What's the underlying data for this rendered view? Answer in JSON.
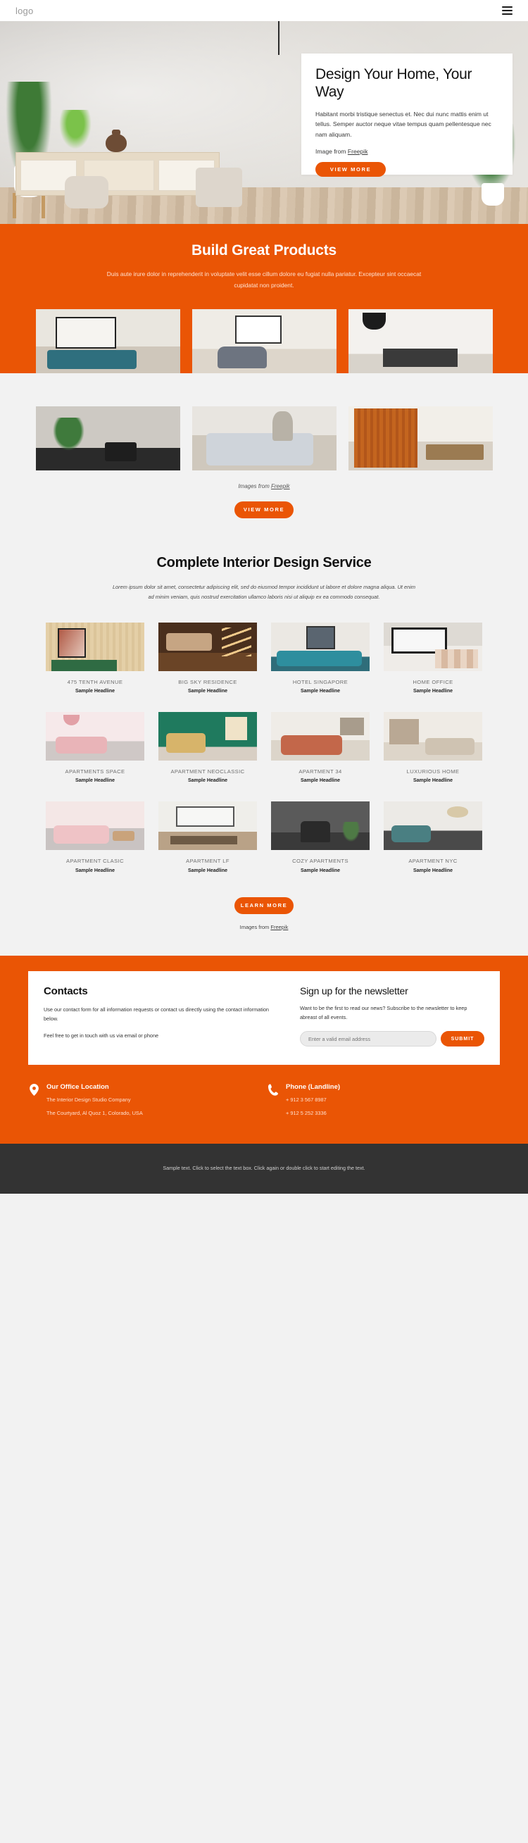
{
  "header": {
    "logo": "logo",
    "menu_icon": "hamburger-icon"
  },
  "hero": {
    "title": "Design Your Home, Your Way",
    "paragraph": "Habitant morbi tristique senectus et. Nec dui nunc mattis enim ut tellus. Semper auctor neque vitae tempus quam pellentesque nec nam aliquam.",
    "credit_prefix": "Image from ",
    "credit_link": "Freepik",
    "cta": "VIEW MORE"
  },
  "band": {
    "title": "Build Great Products",
    "paragraph": "Duis aute irure dolor in reprehenderit in voluptate velit esse cillum dolore eu fugiat nulla pariatur. Excepteur sint occaecat cupidatat non proident.",
    "credit_prefix": "Images from ",
    "credit_link": "Freepik",
    "cta": "VIEW MORE"
  },
  "service": {
    "title": "Complete Interior Design Service",
    "lead": "Lorem ipsum dolor sit amet, consectetur adipiscing elit, sed do eiusmod tempor incididunt ut labore et dolore magna aliqua. Ut enim ad minim veniam, quis nostrud exercitation ullamco laboris nisi ut aliquip ex ea commodo consequat.",
    "cta": "LEARN MORE",
    "credit_prefix": "Images from ",
    "credit_link": "Freepik",
    "cards": [
      {
        "title": "475 TENTH AVENUE",
        "subtitle": "Sample Headline"
      },
      {
        "title": "BIG SKY RESIDENCE",
        "subtitle": "Sample Headline"
      },
      {
        "title": "HOTEL SINGAPORE",
        "subtitle": "Sample Headline"
      },
      {
        "title": "HOME OFFICE",
        "subtitle": "Sample Headline"
      },
      {
        "title": "APARTMENTS SPACE",
        "subtitle": "Sample Headline"
      },
      {
        "title": "APARTMENT NEOCLASSIC",
        "subtitle": "Sample Headline"
      },
      {
        "title": "APARTMENT 34",
        "subtitle": "Sample Headline"
      },
      {
        "title": "LUXURIOUS HOME",
        "subtitle": "Sample Headline"
      },
      {
        "title": "APARTMENT CLASIC",
        "subtitle": "Sample Headline"
      },
      {
        "title": "APARTMENT LF",
        "subtitle": "Sample Headline"
      },
      {
        "title": "COZY APARTMENTS",
        "subtitle": "Sample Headline"
      },
      {
        "title": "APARTMENT NYC",
        "subtitle": "Sample Headline"
      }
    ]
  },
  "contacts": {
    "heading": "Contacts",
    "paragraph1": "Use our contact form for all information requests or contact us directly using the contact information below.",
    "paragraph2": "Feel free to get in touch with us via email or phone",
    "newsletter_heading": "Sign up for the newsletter",
    "newsletter_paragraph": "Want to be the first to read our news? Subscribe to the newsletter to keep abreast of all events.",
    "email_placeholder": "Enter a valid email address",
    "email_value": "",
    "submit_label": "SUBMIT",
    "office": {
      "icon": "location-pin-icon",
      "heading": "Our Office Location",
      "line1": "The Interior Design Studio Company",
      "line2": "The Courtyard, Al Quoz 1, Colorado,  USA"
    },
    "phone": {
      "icon": "phone-icon",
      "heading": "Phone (Landline)",
      "line1": "+ 912 3 567 8987",
      "line2": "+ 912 5 252 3336"
    }
  },
  "footer": {
    "text": "Sample text. Click to select the text box. Click again or double click to start editing the text."
  },
  "colors": {
    "accent": "#ea5505",
    "band_text": "#ffe2d3",
    "footer_bg": "#333333",
    "page_bg": "#f2f2f2"
  }
}
